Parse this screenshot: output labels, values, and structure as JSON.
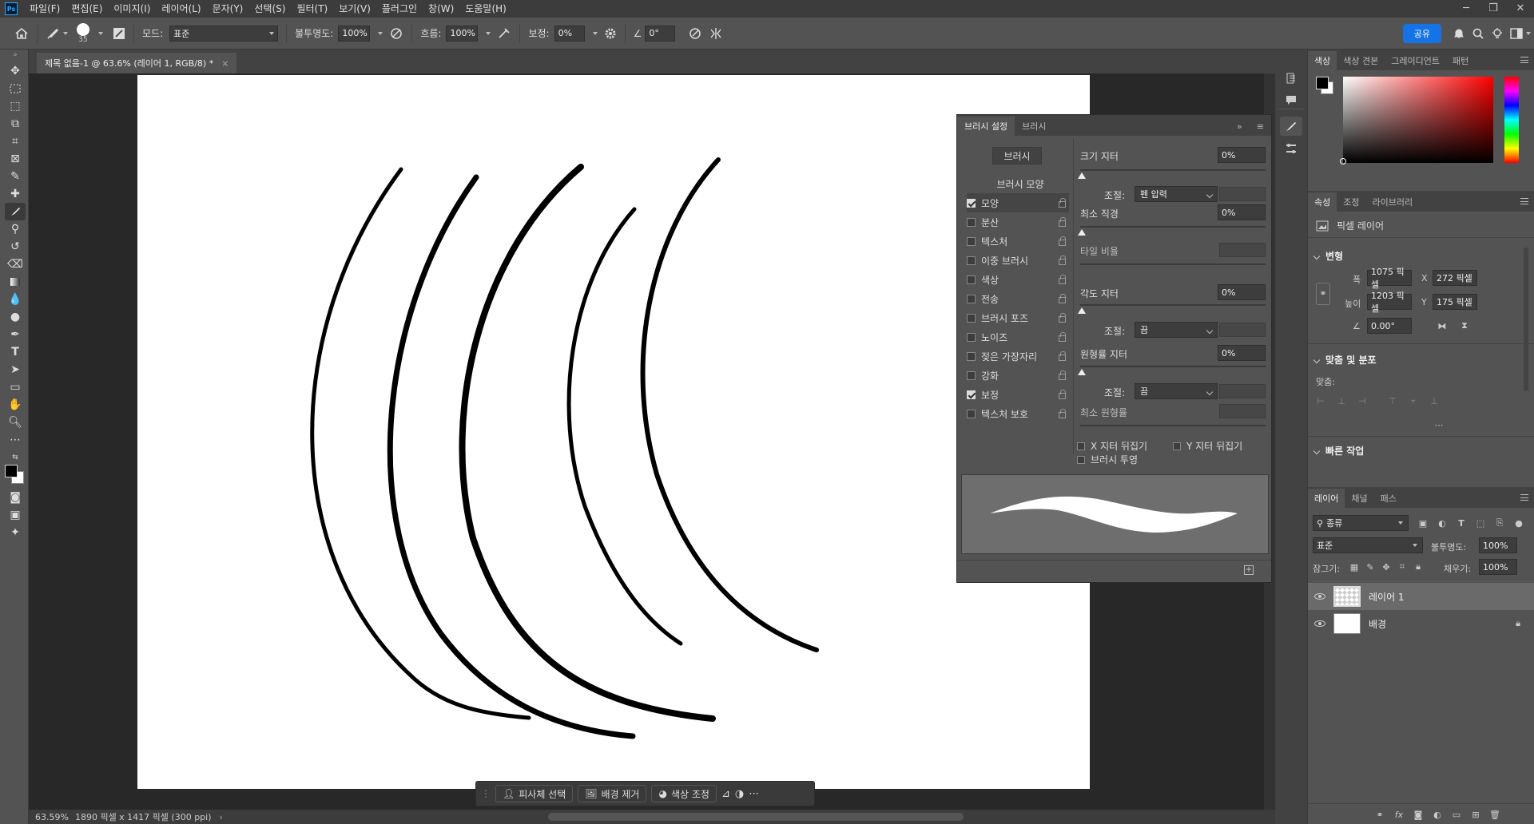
{
  "menu": {
    "items": [
      "파일(F)",
      "편집(E)",
      "이미지(I)",
      "레이어(L)",
      "문자(Y)",
      "선택(S)",
      "필터(T)",
      "보기(V)",
      "플러그인",
      "창(W)",
      "도움말(H)"
    ],
    "logo": "Ps"
  },
  "options": {
    "brush_size": "35",
    "mode_label": "모드:",
    "mode_value": "표준",
    "opacity_label": "불투명도:",
    "opacity_value": "100%",
    "flow_label": "흐름:",
    "flow_value": "100%",
    "smoothing_label": "보정:",
    "smoothing_value": "0%",
    "angle_value": "0°",
    "share_label": "공유"
  },
  "document": {
    "tab_title": "제목 없음-1 @ 63.6% (레이어 1, RGB/8) *",
    "zoom": "63.59%",
    "doc_info": "1890 픽셀 x 1417 픽셀 (300 ppi)"
  },
  "context_bar": {
    "select_subject": "피사체 선택",
    "remove_bg": "배경 제거",
    "color_adjust": "색상 조정"
  },
  "brush_panel": {
    "tab_settings": "브러시 설정",
    "tab_brushes": "브러시",
    "brushes_button": "브러시",
    "tip_shape_title": "브러시 모양",
    "options": [
      {
        "label": "모양",
        "checked": true
      },
      {
        "label": "분산",
        "checked": false
      },
      {
        "label": "텍스처",
        "checked": false
      },
      {
        "label": "이중 브러시",
        "checked": false
      },
      {
        "label": "색상",
        "checked": false
      },
      {
        "label": "전송",
        "checked": false
      },
      {
        "label": "브러시 포즈",
        "checked": false
      },
      {
        "label": "노이즈",
        "checked": false
      },
      {
        "label": "젖은 가장자리",
        "checked": false
      },
      {
        "label": "강화",
        "checked": false
      },
      {
        "label": "보정",
        "checked": true
      },
      {
        "label": "텍스처 보호",
        "checked": false
      }
    ],
    "size_jitter_label": "크기 지터",
    "size_jitter_value": "0%",
    "control_label": "조절:",
    "control1_value": "펜 압력",
    "min_diameter_label": "최소 직경",
    "min_diameter_value": "0%",
    "tilt_scale_label": "타일 비율",
    "angle_jitter_label": "각도 지터",
    "angle_jitter_value": "0%",
    "control2_value": "끔",
    "roundness_jitter_label": "원형률 지터",
    "roundness_jitter_value": "0%",
    "control3_value": "끔",
    "min_roundness_label": "최소 원형률",
    "flip_x_label": "X 지터 뒤집기",
    "flip_y_label": "Y 지터 뒤집기",
    "projection_label": "브러시 투영"
  },
  "color_panel": {
    "tabs": [
      "색상",
      "색상 견본",
      "그레이디언트",
      "패턴"
    ]
  },
  "properties_panel": {
    "tabs": [
      "속성",
      "조정",
      "라이브러리"
    ],
    "layer_kind": "픽셀 레이어",
    "transform_title": "변형",
    "width_label": "폭",
    "width_value": "1075 픽셀",
    "height_label": "높이",
    "height_value": "1203 픽셀",
    "x_label": "X",
    "x_value": "272 픽셀",
    "y_label": "Y",
    "y_value": "175 픽셀",
    "angle_value": "0.00°",
    "align_title": "맞춤 및 분포",
    "align_label": "맞춤:",
    "quick_actions_title": "빠른 작업"
  },
  "layers_panel": {
    "tabs": [
      "레이어",
      "채널",
      "패스"
    ],
    "filter_kind": "종류",
    "blend_mode": "표준",
    "opacity_label": "불투명도:",
    "opacity_value": "100%",
    "lock_label": "잠그기:",
    "fill_label": "채우기:",
    "fill_value": "100%",
    "layers": [
      {
        "name": "레이어 1",
        "selected": true
      },
      {
        "name": "배경",
        "selected": false,
        "locked": true
      }
    ]
  },
  "colors": {
    "accent": "#1473e6",
    "panel_bg": "#535353",
    "dark_bg": "#282828"
  }
}
